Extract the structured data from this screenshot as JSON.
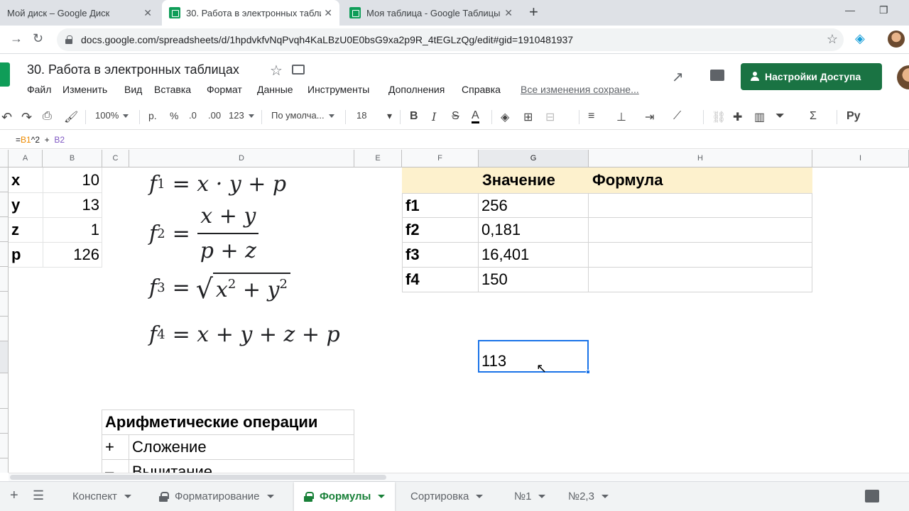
{
  "browser": {
    "tabs": [
      {
        "title": "Мой диск – Google Диск",
        "favicon": "google-drive-icon"
      },
      {
        "title": "30. Работа в электронных табли",
        "favicon": "google-sheets-icon",
        "active": true
      },
      {
        "title": "Моя таблица - Google Таблицы",
        "favicon": "google-sheets-icon"
      }
    ],
    "new_tab": "+",
    "url": "docs.google.com/spreadsheets/d/1hpdvkfvNqPvqh4KaLBzU0E0bsG9xa2p9R_4tEGLzQg/edit#gid=1910481937"
  },
  "doc": {
    "title": "30. Работа в электронных таблицах",
    "menu": [
      "Файл",
      "Изменить",
      "Вид",
      "Вставка",
      "Формат",
      "Данные",
      "Инструменты",
      "Дополнения",
      "Справка"
    ],
    "save_status": "Все изменения сохране...",
    "share_label": "Настройки Доступа"
  },
  "toolbar": {
    "zoom": "100%",
    "currency": "р.",
    "percent": "%",
    "dec_less": ".0",
    "dec_more": ".00",
    "more_formats": "123",
    "font": "По умолча...",
    "font_size": "18"
  },
  "formula_bar": {
    "prefix": "=",
    "ref1": "B1",
    "op1": "^2  +  ",
    "ref2": "B2"
  },
  "grid": {
    "columns": [
      "A",
      "B",
      "C",
      "D",
      "E",
      "F",
      "G",
      "H",
      "I"
    ],
    "vars": [
      {
        "name": "x",
        "value": "10"
      },
      {
        "name": "y",
        "value": "13"
      },
      {
        "name": "z",
        "value": "1"
      },
      {
        "name": "p",
        "value": "126"
      }
    ],
    "results_table": {
      "headers": [
        "Значение",
        "Формула"
      ],
      "rows": [
        {
          "label": "f1",
          "value": "256",
          "formula": ""
        },
        {
          "label": "f2",
          "value": "0,181",
          "formula": ""
        },
        {
          "label": "f3",
          "value": "16,401",
          "formula": ""
        },
        {
          "label": "f4",
          "value": "150",
          "formula": ""
        }
      ]
    },
    "selected_cell_value": "113",
    "ops_table": {
      "title": "Арифметические операции",
      "rows": [
        {
          "sign": "+",
          "name": "Сложение"
        },
        {
          "sign": "–",
          "name": "Вычитание"
        }
      ]
    },
    "formulas": {
      "f1": {
        "lhs": "f",
        "idx": "1",
        "rhs": "= x · y + p"
      },
      "f2": {
        "lhs": "f",
        "idx": "2",
        "num": "x + y",
        "den": "p + z"
      },
      "f3": {
        "lhs": "f",
        "idx": "3",
        "x": "x",
        "y": "y",
        "exp": "2"
      },
      "f4": {
        "lhs": "f",
        "idx": "4",
        "rhs": "= x + y + z + p"
      }
    }
  },
  "sheets": [
    {
      "name": "Конспект",
      "locked": false
    },
    {
      "name": "Форматирование",
      "locked": true
    },
    {
      "name": "Формулы",
      "locked": true,
      "active": true
    },
    {
      "name": "Сортировка",
      "locked": false
    },
    {
      "name": "№1",
      "locked": false
    },
    {
      "name": "№2,3",
      "locked": false
    }
  ],
  "colors": {
    "accent": "#1a73e8",
    "share_button": "#1a7343",
    "header_fill": "#fdf1cd",
    "active_sheet": "#188038"
  }
}
